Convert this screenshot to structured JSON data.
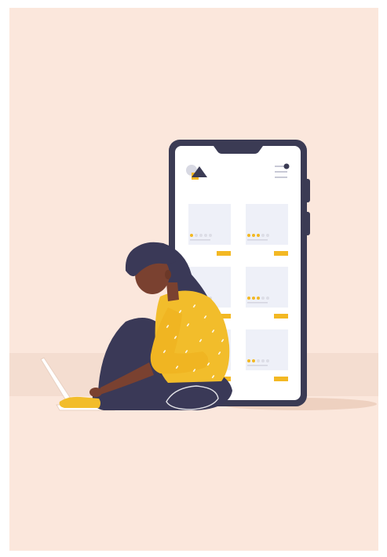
{
  "colors": {
    "background": "#fbe7dc",
    "floor_shadow": "#f2d5c5",
    "phone_body": "#3b3b54",
    "phone_screen": "#ffffff",
    "card": "#eef0f8",
    "star_on": "#f3b823",
    "star_off": "#dcdde6",
    "button": "#f3b823",
    "hair": "#3a3957",
    "skin": "#7a4130",
    "sweater": "#f2bd2b",
    "pants": "#3a3957",
    "shoe": "#f2bd2b"
  },
  "illustration": {
    "subject": "woman-with-laptop-icon",
    "device": "smartphone-icon"
  },
  "app_screen": {
    "logo_icon": "shapes-logo-icon",
    "menu_icon": "hamburger-menu-icon",
    "product_cards": [
      {
        "rating": 1,
        "max_rating": 5
      },
      {
        "rating": 3,
        "max_rating": 5
      },
      {
        "rating": 0,
        "max_rating": 5
      },
      {
        "rating": 3,
        "max_rating": 5
      },
      {
        "rating": 0,
        "max_rating": 5
      },
      {
        "rating": 2,
        "max_rating": 5
      }
    ]
  }
}
